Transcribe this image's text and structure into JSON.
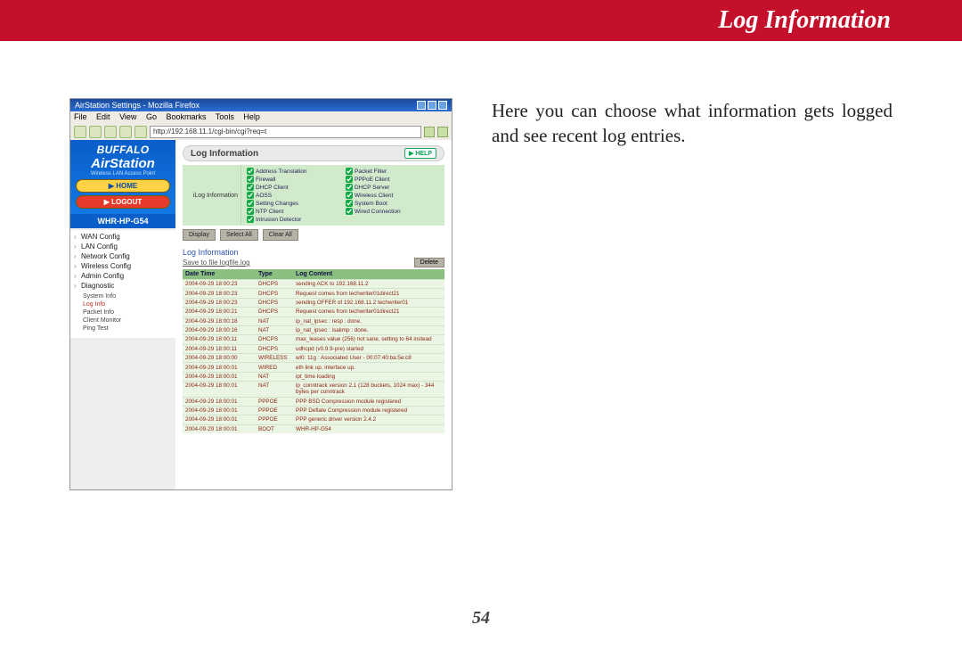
{
  "header": {
    "title": "Log Information"
  },
  "description": "Here you can choose what information gets logged and see recent log entries.",
  "page_number": "54",
  "browser": {
    "window_title": "AirStation Settings - Mozilla Firefox",
    "menus": [
      "File",
      "Edit",
      "View",
      "Go",
      "Bookmarks",
      "Tools",
      "Help"
    ],
    "url": "http://192.168.11.1/cgi-bin/cgi?req=t"
  },
  "sidebar": {
    "brand_top": "BUFFALO",
    "brand_main": "AirStation",
    "brand_sub": "Wireless LAN Access Point",
    "home": "HOME",
    "logout": "LOGOUT",
    "model": "WHR-HP-G54",
    "items": [
      {
        "label": "WAN Config"
      },
      {
        "label": "LAN Config"
      },
      {
        "label": "Network Config"
      },
      {
        "label": "Wireless Config"
      },
      {
        "label": "Admin Config"
      },
      {
        "label": "Diagnostic"
      }
    ],
    "subitems": [
      {
        "label": "System Info",
        "active": false
      },
      {
        "label": "Log Info",
        "active": true
      },
      {
        "label": "Packet Info",
        "active": false
      },
      {
        "label": "Client Monitor",
        "active": false
      },
      {
        "label": "Ping Test",
        "active": false
      }
    ]
  },
  "panel": {
    "title": "Log Information",
    "help": "HELP",
    "checks_label": "iLog Information",
    "checks": [
      "Address Translation",
      "Packet Filter",
      "Firewall",
      "PPPoE Client",
      "DHCP Client",
      "DHCP Server",
      "AOSS",
      "Wireless Client",
      "Setting Changes",
      "System Boot",
      "NTP Client",
      "Wired Connection",
      "Intrusion Detector",
      ""
    ],
    "buttons": {
      "display": "Display",
      "select_all": "Select All",
      "clear_all": "Clear All"
    },
    "section": "Log Information",
    "save_link": "Save to file logfile.log",
    "delete": "Delete",
    "cols": {
      "dt": "Date Time",
      "ty": "Type",
      "lc": "Log Content"
    },
    "rows": [
      {
        "dt": "2004-09-29 18:00:23",
        "ty": "DHCPS",
        "lc": "sending ACK to 192.168.11.2"
      },
      {
        "dt": "2004-09-29 18:00:23",
        "ty": "DHCPS",
        "lc": "Request comes from techwriter01direct21"
      },
      {
        "dt": "2004-09-29 18:00:23",
        "ty": "DHCPS",
        "lc": "sending OFFER of 192.168.11.2 techwriter01"
      },
      {
        "dt": "2004-09-29 18:00:21",
        "ty": "DHCPS",
        "lc": "Request comes from techwriter01direct21"
      },
      {
        "dt": "2004-09-29 18:00:18",
        "ty": "NAT",
        "lc": "ip_nat_ipsec : resp : done."
      },
      {
        "dt": "2004-09-29 18:00:16",
        "ty": "NAT",
        "lc": "ip_nat_ipsec : isakmp : done."
      },
      {
        "dt": "2004-09-29 18:00:11",
        "ty": "DHCPS",
        "lc": "max_leases value (256) not sane, setting to 64 instead"
      },
      {
        "dt": "2004-09-29 18:00:11",
        "ty": "DHCPS",
        "lc": "udhcpd (v0.9.9-pre) started"
      },
      {
        "dt": "2004-09-29 18:00:00",
        "ty": "WIRELESS",
        "lc": "wl0: 11g : Associated User - 00:07:40:ba:5e:c8"
      },
      {
        "dt": "2004-09-29 18:00:01",
        "ty": "WIRED",
        "lc": "eth link up. interface up."
      },
      {
        "dt": "2004-09-29 18:00:01",
        "ty": "NAT",
        "lc": "ipt_time loading"
      },
      {
        "dt": "2004-09-29 18:00:01",
        "ty": "NAT",
        "lc": "ip_conntrack version 2.1 (128 buckets, 1024 max) - 344 bytes per conntrack"
      },
      {
        "dt": "2004-09-29 18:00:01",
        "ty": "PPPOE",
        "lc": "PPP BSD Compression module registered"
      },
      {
        "dt": "2004-09-29 18:00:01",
        "ty": "PPPOE",
        "lc": "PPP Deflate Compression module registered"
      },
      {
        "dt": "2004-09-29 18:00:01",
        "ty": "PPPOE",
        "lc": "PPP generic driver version 2.4.2"
      },
      {
        "dt": "2004-09-29 18:00:01",
        "ty": "BOOT",
        "lc": "WHR-HP-G54"
      }
    ]
  }
}
